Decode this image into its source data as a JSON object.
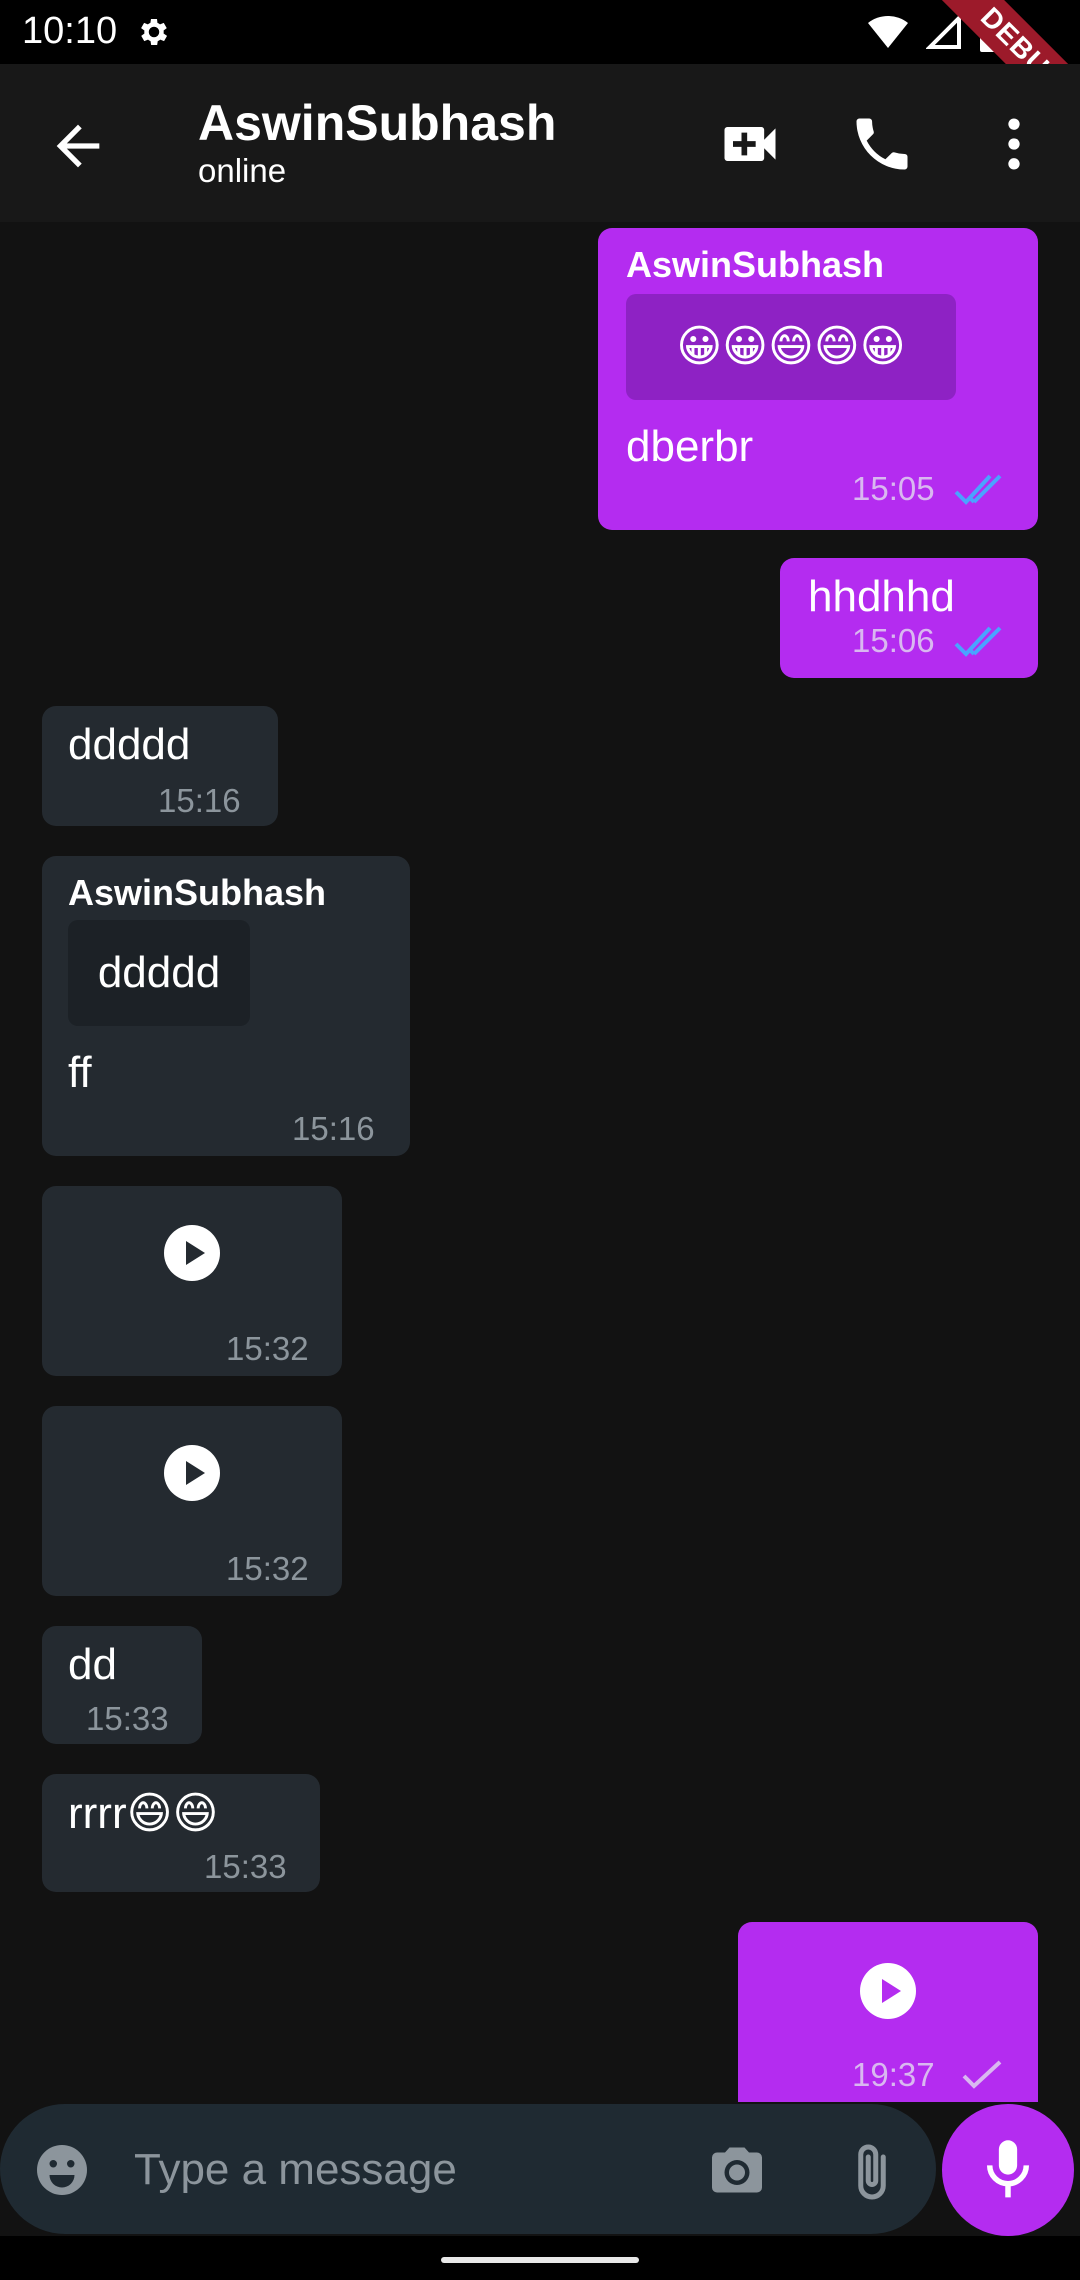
{
  "status_bar": {
    "time": "10:10",
    "debug_banner": "DEBUG",
    "icons": [
      "settings-gear-icon",
      "wifi-icon",
      "signal-icon",
      "battery-icon"
    ]
  },
  "header": {
    "title": "AswinSubhash",
    "subtitle": "online",
    "actions": [
      "video-call-icon",
      "phone-icon",
      "more-vert-icon"
    ]
  },
  "colors": {
    "outgoing_bubble": "#b42cf0",
    "incoming_bubble": "#242a30",
    "background": "#121212",
    "read_ticks": "#4aa3ff"
  },
  "messages": [
    {
      "direction": "out",
      "sender": "AswinSubhash",
      "quote": "😀😀😄😄😀",
      "text": "dberbr",
      "time": "15:05",
      "status": "read"
    },
    {
      "direction": "out",
      "text": "hhdhhd",
      "time": "15:06",
      "status": "read"
    },
    {
      "direction": "in",
      "text": "ddddd",
      "time": "15:16"
    },
    {
      "direction": "in",
      "sender": "AswinSubhash",
      "quote": "ddddd",
      "text": "ff",
      "time": "15:16"
    },
    {
      "direction": "in",
      "type": "audio",
      "time": "15:32"
    },
    {
      "direction": "in",
      "type": "audio",
      "time": "15:32"
    },
    {
      "direction": "in",
      "text": "dd",
      "time": "15:33"
    },
    {
      "direction": "in",
      "text": "rrrr😄😄",
      "time": "15:33"
    },
    {
      "direction": "out",
      "type": "audio",
      "time": "19:37",
      "status": "sent"
    }
  ],
  "composer": {
    "placeholder": "Type a message"
  }
}
